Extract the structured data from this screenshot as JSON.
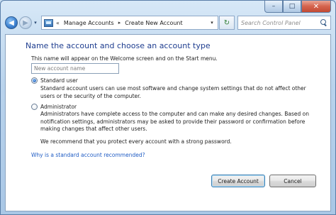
{
  "window": {
    "caption_buttons": {
      "minimize_glyph": "–",
      "maximize_glyph": "□",
      "close_glyph": "✕"
    }
  },
  "nav": {
    "back_glyph": "◀",
    "forward_glyph": "▶",
    "dropdown_glyph": "▾",
    "refresh_glyph": "↻"
  },
  "address": {
    "lead_sep": "«",
    "crumbs": [
      "Manage Accounts",
      "Create New Account"
    ],
    "separator": "▸",
    "dropdown_glyph": "▾"
  },
  "search": {
    "placeholder": "Search Control Panel"
  },
  "main": {
    "heading": "Name the account and choose an account type",
    "subtext": "This name will appear on the Welcome screen and on the Start menu.",
    "name_placeholder": "New account name",
    "options": [
      {
        "label": "Standard user",
        "checked": true,
        "description": "Standard account users can use most software and change system settings that do not affect other users or the security of the computer."
      },
      {
        "label": "Administrator",
        "checked": false,
        "description": "Administrators have complete access to the computer and can make any desired changes. Based on notification settings, administrators may be asked to provide their password or confirmation before making changes that affect other users."
      }
    ],
    "recommendation": "We recommend that you protect every account with a strong password.",
    "help_link": "Why is a standard account recommended?"
  },
  "buttons": {
    "create": "Create Account",
    "cancel": "Cancel"
  },
  "colors": {
    "heading": "#1e3d8f",
    "link": "#1f5cc4",
    "close_button": "#c34a34"
  }
}
